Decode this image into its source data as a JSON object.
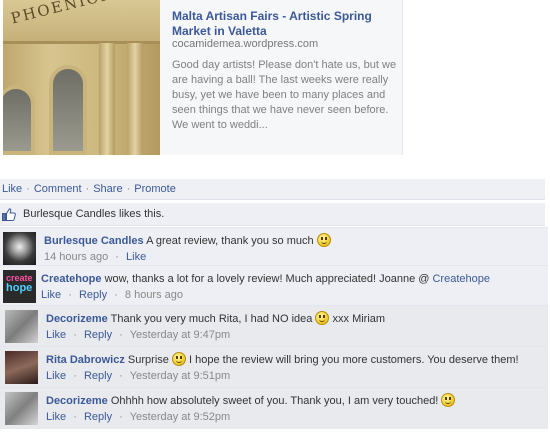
{
  "link_card": {
    "image_sign_text": "PHOENICIA",
    "title": "Malta Artisan Fairs - Artistic Spring Market in Valetta",
    "domain": "cocamidemea.wordpress.com",
    "description": "Good day artists! Please don't hate us, but we are having a ball! The last weeks were really busy, yet we have been to many places and seen things that we have never seen before. We went to weddi..."
  },
  "actions": {
    "like": "Like",
    "comment": "Comment",
    "share": "Share",
    "promote": "Promote",
    "separator": "·"
  },
  "likes": {
    "icon": "thumbs-up-icon",
    "page_name": "Burlesque Candles",
    "suffix": " likes this."
  },
  "comments": [
    {
      "author": "Burlesque Candles",
      "text": " A great review, thank you so much ",
      "has_smiley": true,
      "time": "14 hours ago",
      "actions": [
        "Like"
      ]
    },
    {
      "author": "Createhope",
      "text": " wow, thanks a lot for a lovely review! Much appreciated! Joanne @ ",
      "mention": "Createhope",
      "avatar_text": [
        "create",
        "hope"
      ],
      "time": "8 hours ago",
      "actions": [
        "Like",
        "Reply"
      ]
    },
    {
      "author": "Decorizeme",
      "text": " Thank you very much Rita, I had NO idea ",
      "text_after": " xxx Miriam",
      "has_smiley": true,
      "time": "Yesterday at 9:47pm",
      "actions": [
        "Like",
        "Reply"
      ]
    },
    {
      "author": "Rita Dabrowicz",
      "text": " Surprise ",
      "text_after": " I hope the review will bring you more customers. You deserve them!",
      "has_smiley": true,
      "time": "Yesterday at 9:51pm",
      "actions": [
        "Like",
        "Reply"
      ]
    },
    {
      "author": "Decorizeme",
      "text": " Ohhhh how absolutely sweet of you. Thank you, I am very touched! ",
      "has_smiley": true,
      "time": "Yesterday at 9:52pm",
      "actions": [
        "Like",
        "Reply"
      ]
    }
  ],
  "colors": {
    "link_blue": "#3b5998",
    "panel_bg": "#edeff4",
    "meta_gray": "#888888"
  }
}
